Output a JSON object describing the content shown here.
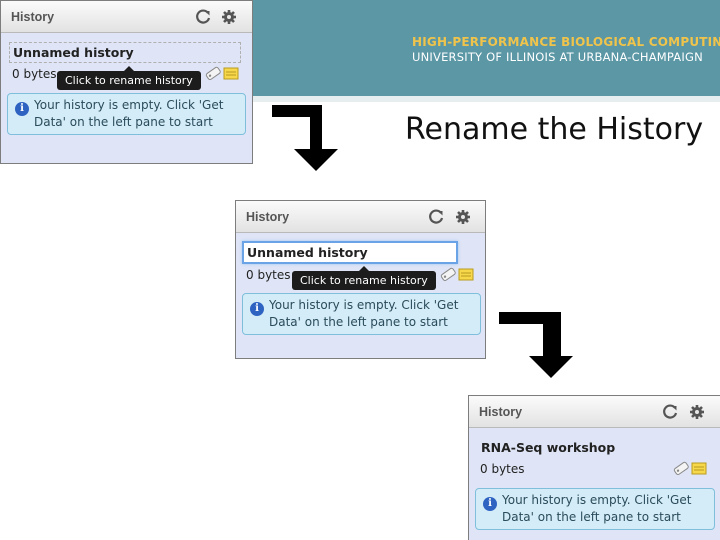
{
  "banner": {
    "line1": "HIGH-PERFORMANCE BIOLOGICAL COMPUTING",
    "line2": "UNIVERSITY OF ILLINOIS AT URBANA-CHAMPAIGN"
  },
  "slide_title": "Rename the History",
  "panels": [
    {
      "title": "History",
      "history_name": "Unnamed history",
      "size": "0 bytes",
      "tooltip": "Click to rename history",
      "message": "Your history is empty. Click 'Get Data' on the left pane to start"
    },
    {
      "title": "History",
      "history_name": "Unnamed history",
      "size": "0 bytes",
      "tooltip": "Click to rename history",
      "message": "Your history is empty. Click 'Get Data' on the left pane to start"
    },
    {
      "title": "History",
      "history_name": "RNA-Seq workshop",
      "size": "0 bytes",
      "message": "Your history is empty. Click 'Get Data' on the left pane to start"
    }
  ],
  "colors": {
    "banner": "#5b97a5",
    "banner_text_accent": "#f0c44b",
    "panel_bg": "#dfe5f6",
    "message_bg": "#d4ecf7",
    "info_icon": "#2e63c2"
  },
  "icons": [
    "refresh-icon",
    "gear-icon",
    "tag-icon",
    "annotation-icon",
    "info-icon",
    "arrow-down-icon"
  ]
}
